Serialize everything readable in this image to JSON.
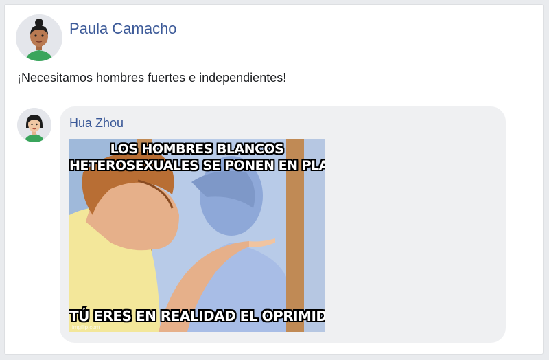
{
  "post": {
    "author": "Paula Camacho",
    "text": "¡Necesitamos hombres fuertes e independientes!"
  },
  "comment": {
    "author": "Hua Zhou",
    "meme": {
      "top_caption_line1": "LOS HOMBRES BLANCOS",
      "top_caption_line2": "HETEROSEXUALES SE PONEN EN PLAN:",
      "bottom_caption": "TÚ ERES EN REALIDAD EL OPRIMIDO",
      "watermark": "imgflip.com"
    }
  }
}
